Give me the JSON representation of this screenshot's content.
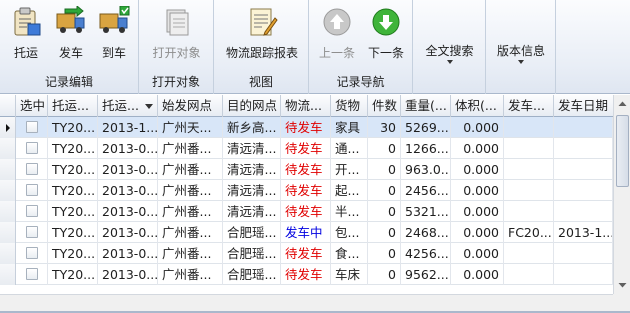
{
  "ribbon": {
    "groups": [
      {
        "label": "记录编辑",
        "buttons": [
          "托运",
          "发车",
          "到车"
        ]
      },
      {
        "label": "打开对象",
        "buttons": [
          "打开对象"
        ]
      },
      {
        "label": "视图",
        "buttons": [
          "物流跟踪报表"
        ]
      },
      {
        "label": "记录导航",
        "buttons": [
          "上一条",
          "下一条"
        ]
      }
    ],
    "dropdowns": [
      "全文搜索",
      "版本信息"
    ]
  },
  "grid": {
    "columns": [
      "选中",
      "托运...",
      "托运...",
      "始发网点",
      "目的网点",
      "物流...",
      "货物",
      "件数",
      "重量(...",
      "体积(...",
      "发车...",
      "发车日期"
    ],
    "rows": [
      [
        "",
        "TY20...",
        "2013-1...",
        "广州天...",
        "新乡高...",
        "待发车",
        "家具",
        "30",
        "5269....",
        "0.000",
        "",
        ""
      ],
      [
        "",
        "TY20...",
        "2013-0...",
        "广州番...",
        "清远清...",
        "待发车",
        "通...",
        "0",
        "1266....",
        "0.000",
        "",
        ""
      ],
      [
        "",
        "TY20...",
        "2013-0...",
        "广州番...",
        "清远清...",
        "待发车",
        "开...",
        "0",
        "963.0...",
        "0.000",
        "",
        ""
      ],
      [
        "",
        "TY20...",
        "2013-0...",
        "广州番...",
        "清远清...",
        "待发车",
        "起...",
        "0",
        "2456....",
        "0.000",
        "",
        ""
      ],
      [
        "",
        "TY20...",
        "2013-0...",
        "广州番...",
        "清远清...",
        "待发车",
        "半...",
        "0",
        "5321....",
        "0.000",
        "",
        ""
      ],
      [
        "",
        "TY20...",
        "2013-0...",
        "广州番...",
        "合肥瑶...",
        "发车中",
        "包...",
        "0",
        "2468....",
        "0.000",
        "FC20...",
        "2013-1..."
      ],
      [
        "",
        "TY20...",
        "2013-0...",
        "广州番...",
        "合肥瑶...",
        "待发车",
        "食...",
        "0",
        "4256....",
        "0.000",
        "",
        ""
      ],
      [
        "",
        "TY20...",
        "2013-0...",
        "广州番...",
        "合肥瑶...",
        "待发车",
        "车床",
        "0",
        "9562....",
        "0.000",
        "",
        ""
      ]
    ],
    "status_colors": {
      "待发车": "#e00000",
      "发车中": "#0000e0"
    },
    "selected_row": 0
  }
}
